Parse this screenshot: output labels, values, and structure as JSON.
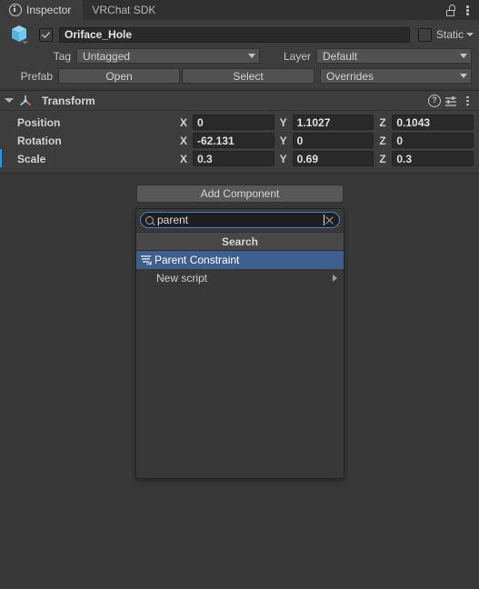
{
  "window": {
    "tabs": [
      {
        "label": "Inspector",
        "icon": "info-icon",
        "active": true
      },
      {
        "label": "VRChat SDK",
        "active": false
      }
    ],
    "lock_icon": "lock-open-icon",
    "menu_icon": "kebab-menu-icon"
  },
  "gameobject": {
    "icon": "prefab-cube-icon",
    "enabled": true,
    "name": "Oriface_Hole",
    "name_placeholder": "Name",
    "static_label": "Static",
    "static_checked": false,
    "tag_label": "Tag",
    "tag_value": "Untagged",
    "layer_label": "Layer",
    "layer_value": "Default",
    "prefab_label": "Prefab",
    "prefab_open": "Open",
    "prefab_select": "Select",
    "prefab_overrides": "Overrides"
  },
  "transform": {
    "title": "Transform",
    "help_icon": "help-icon",
    "preset_icon": "preset-icon",
    "menu_icon": "kebab-menu-icon",
    "axis_x": "X",
    "axis_y": "Y",
    "axis_z": "Z",
    "rows": [
      {
        "label": "Position",
        "x": "0",
        "y": "1.1027",
        "z": "0.1043",
        "overridden": false
      },
      {
        "label": "Rotation",
        "x": "-62.131",
        "y": "0",
        "z": "0",
        "overridden": false
      },
      {
        "label": "Scale",
        "x": "0.3",
        "y": "0.69",
        "z": "0.3",
        "overridden": true
      }
    ]
  },
  "add_component": {
    "button_label": "Add Component",
    "search_value": "parent",
    "search_placeholder": "Search",
    "search_icon": "search-icon",
    "clear_icon": "clear-icon",
    "results_header": "Search",
    "results": [
      {
        "label": "Parent Constraint",
        "icon": "parent-constraint-icon",
        "selected": true,
        "has_submenu": false
      },
      {
        "label": "New script",
        "icon": "",
        "selected": false,
        "has_submenu": true
      }
    ]
  },
  "colors": {
    "accent_selection": "#3f5f8f",
    "focus_border": "#4a7fd4",
    "override_marker": "#2196f3",
    "panel_bg": "#383838",
    "header_bg": "#3d3d3d"
  }
}
